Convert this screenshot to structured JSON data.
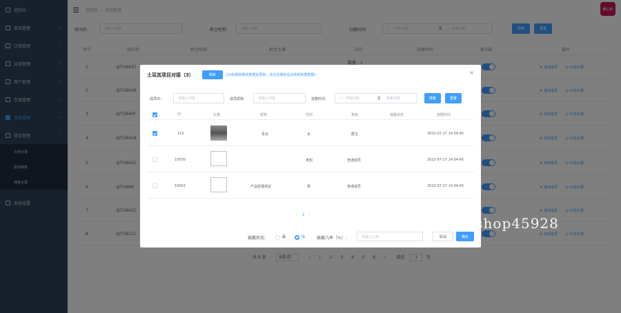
{
  "sidebar": {
    "items": [
      {
        "label": "控制台"
      },
      {
        "label": "商品管理"
      },
      {
        "label": "订单管理"
      },
      {
        "label": "运营管理"
      },
      {
        "label": "用户管理"
      },
      {
        "label": "交易管理"
      },
      {
        "label": "游戏管理"
      },
      {
        "label": "资金管理"
      },
      {
        "label": "系统设置"
      }
    ],
    "sub_items": [
      {
        "label": "充值记录"
      },
      {
        "label": "提现审核"
      },
      {
        "label": "佣金记录"
      }
    ]
  },
  "header": {
    "crumbs": [
      "控制台",
      "游戏管理"
    ],
    "avatar_text": "暖心的"
  },
  "filter": {
    "room_label": "房间名:",
    "room_placeholder": "请输入内容",
    "owner_label": "群主昵称:",
    "owner_placeholder": "请输入内容",
    "time_label": "创建时间:",
    "start_placeholder": "开始日期",
    "range_sep": "至",
    "end_placeholder": "结束日期",
    "search_btn": "搜索",
    "reset_btn": "重置"
  },
  "base_table": {
    "columns": [
      "序号",
      "房间名",
      "群主昵称",
      "群主头像",
      "红包",
      "创建时间",
      "群功能",
      "操作"
    ],
    "rows": [
      {
        "index": "1",
        "name": "@TG8437",
        "extra": "数量：1"
      },
      {
        "index": "2",
        "name": "@TG8426"
      },
      {
        "index": "3",
        "name": "@TG840F"
      },
      {
        "index": "4",
        "name": "@TG8419"
      },
      {
        "index": "5",
        "name": "@TG8425"
      },
      {
        "index": "6",
        "name": "@TG8N0"
      },
      {
        "index": "7",
        "name": "@TG841C"
      },
      {
        "index": "8",
        "name": "@TG8111"
      }
    ],
    "op1": "游戏成员",
    "op2": "红包记录",
    "pager": {
      "total": "共 8 条",
      "size": "8条/页",
      "pages": [
        "1",
        "2",
        "3",
        "4",
        "5",
        "6"
      ],
      "goto": "前往",
      "goto_page": "1",
      "page_unit": "页"
    }
  },
  "modal": {
    "title": "土耳其项目对接（3）",
    "refresh_btn": "刷新",
    "tip": "(10秒刷新刷新数据后更新，请点击刷新后出现新数据数据)",
    "close": "×",
    "filter": {
      "id_label": "成员ID:",
      "id_placeholder": "请输入内容",
      "nick_label": "成员昵称:",
      "nick_placeholder": "请输入内容",
      "time_label": "进群时间:",
      "start_placeholder": "开始日期",
      "sep": "至",
      "end_placeholder": "结束日期",
      "search_btn": "搜索",
      "reset_btn": "重置"
    },
    "columns": [
      "ID",
      "头像",
      "昵称",
      "性别",
      "角色",
      "输赢状态",
      "进群时间"
    ],
    "rows": [
      {
        "checked": true,
        "id": "110",
        "photo": true,
        "nick": "青云",
        "gender": "女",
        "role": "群主",
        "status": "",
        "time": "2022-07-27 14:04:45"
      },
      {
        "checked": false,
        "id": "10030",
        "photo": false,
        "nick": "",
        "gender": "未知",
        "role": "普通成员",
        "status": "",
        "time": "2022-07-27 14:04:45"
      },
      {
        "checked": false,
        "id": "10002",
        "photo": false,
        "nick": "产品经理测试",
        "gender": "男",
        "role": "普通成员",
        "status": "",
        "time": "2022-07-27 14:04:45"
      }
    ],
    "pager": {
      "prev": "‹",
      "current": "1",
      "next": "›"
    },
    "footer": {
      "state_label": "输赢状态:",
      "opt_win": "赢",
      "opt_lose": "输",
      "rate_label": "输赢几率（%）:",
      "rate_placeholder": "请输入几率",
      "cancel_btn": "取消",
      "confirm_btn": "确定"
    }
  },
  "watermark": "https://www.huzhan.com/ishop45928"
}
